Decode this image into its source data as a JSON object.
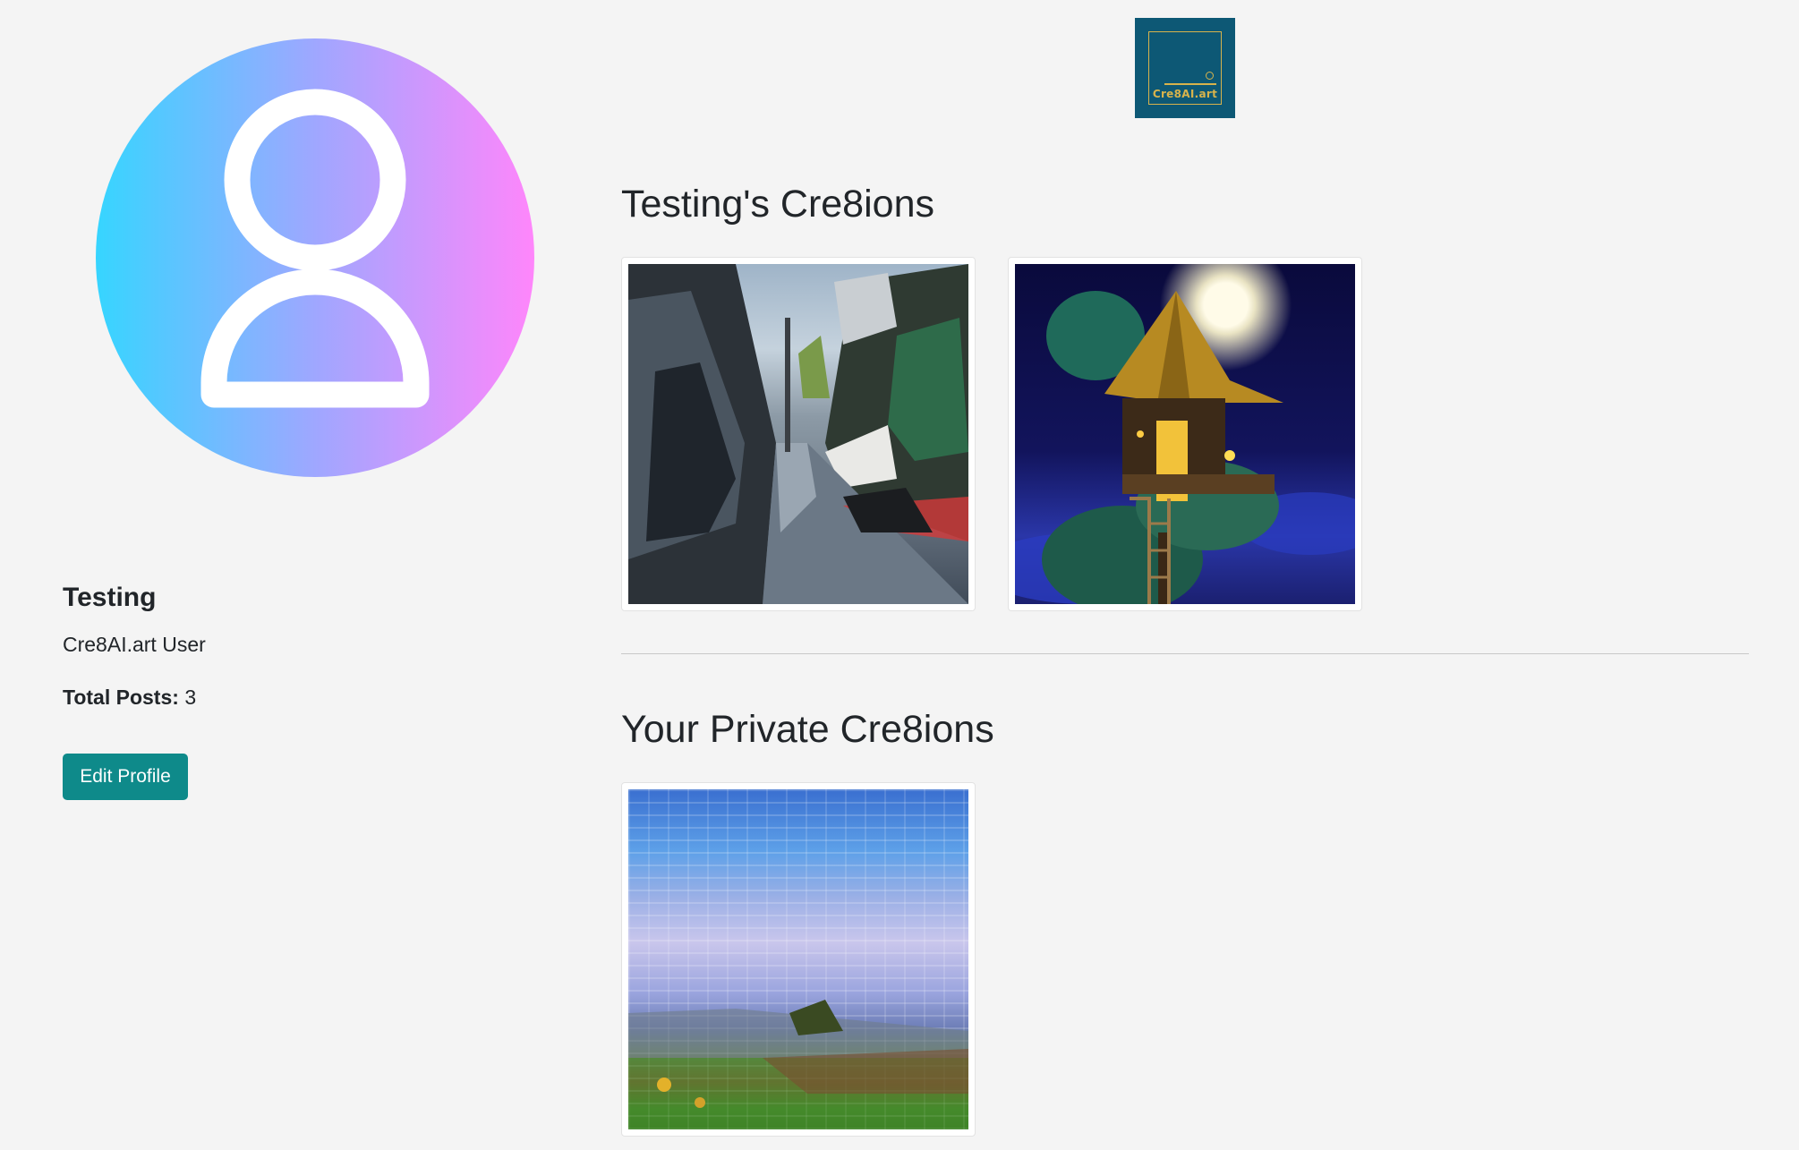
{
  "logo": {
    "text": "Cre8AI.art",
    "icon": "cre8ai-logo-icon"
  },
  "profile": {
    "avatar_icon": "user-avatar-icon",
    "name": "Testing",
    "role": "Cre8AI.art User",
    "posts_label": "Total Posts:",
    "posts_count": "3",
    "edit_button": "Edit Profile"
  },
  "public_section": {
    "title": "Testing's Cre8ions",
    "items": [
      {
        "name": "street-painting"
      },
      {
        "name": "treehouse-painting"
      }
    ]
  },
  "private_section": {
    "title": "Your Private Cre8ions",
    "items": [
      {
        "name": "mosaic-landscape-painting"
      }
    ]
  },
  "colors": {
    "button": "#0e8a8a",
    "logo_bg": "#0d5875",
    "logo_gold": "#d7b34c",
    "avatar_gradient_start": "#36d5ff",
    "avatar_gradient_end": "#ff86fb"
  }
}
